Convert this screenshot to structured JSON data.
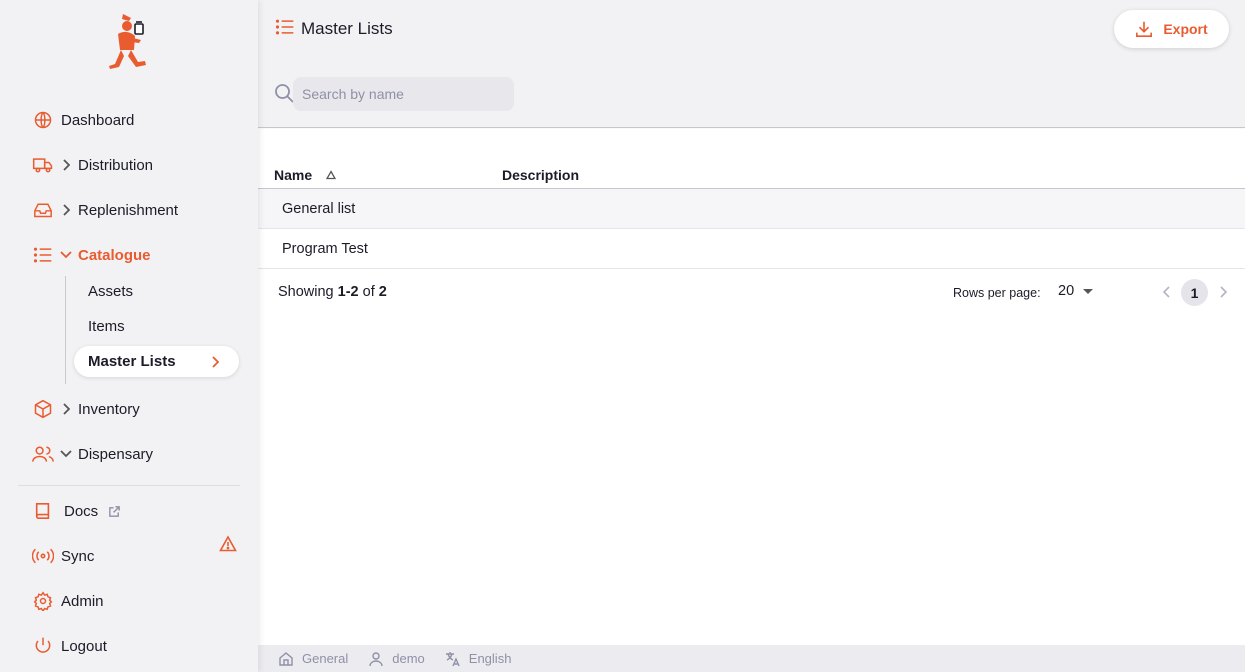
{
  "theme": {
    "accent": "#e95c30",
    "text": "#1c1c28",
    "muted": "#8f90a6"
  },
  "sidebar": {
    "items": [
      {
        "label": "Dashboard",
        "icon": "globe-icon"
      },
      {
        "label": "Distribution",
        "icon": "truck-icon",
        "expandable": true
      },
      {
        "label": "Replenishment",
        "icon": "inbox-icon",
        "expandable": true
      },
      {
        "label": "Catalogue",
        "icon": "list-icon",
        "expanded": true,
        "active": true
      },
      {
        "label": "Inventory",
        "icon": "box-icon",
        "expandable": true
      },
      {
        "label": "Dispensary",
        "icon": "users-icon",
        "expanded": true
      },
      {
        "label": "Docs",
        "icon": "book-icon",
        "external": true
      },
      {
        "label": "Sync",
        "icon": "radio-icon",
        "warning": true
      },
      {
        "label": "Admin",
        "icon": "settings-icon"
      },
      {
        "label": "Logout",
        "icon": "power-icon"
      }
    ],
    "catalogue_sub": [
      {
        "label": "Assets"
      },
      {
        "label": "Items"
      },
      {
        "label": "Master Lists",
        "selected": true
      }
    ]
  },
  "header": {
    "title": "Master Lists",
    "export_label": "Export",
    "search_placeholder": "Search by name"
  },
  "table": {
    "columns": [
      "Name",
      "Description"
    ],
    "rows": [
      {
        "name": "General list",
        "description": ""
      },
      {
        "name": "Program Test",
        "description": ""
      }
    ]
  },
  "pagination": {
    "showing_prefix": "Showing",
    "range": "1-2",
    "of": "of",
    "total": "2",
    "rows_per_page_label": "Rows per page:",
    "rows_per_page": "20",
    "current_page": "1"
  },
  "footer": {
    "store": "General",
    "user": "demo",
    "language": "English"
  }
}
